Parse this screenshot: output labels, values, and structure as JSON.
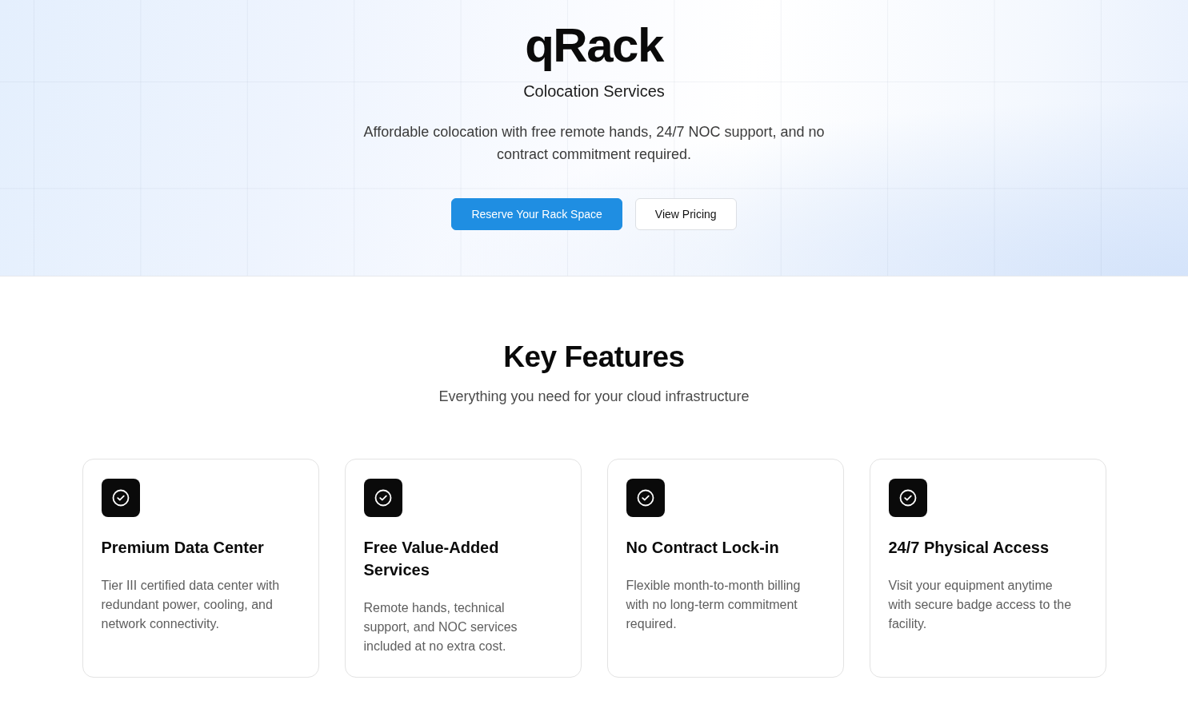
{
  "hero": {
    "brand": "qRack",
    "tagline": "Colocation Services",
    "description": "Affordable colocation with free remote hands, 24/7 NOC support, and no contract commitment required.",
    "buttons": [
      {
        "label": "Reserve Your Rack Space",
        "kind": "primary"
      },
      {
        "label": "View Pricing",
        "kind": "secondary"
      }
    ]
  },
  "features": {
    "title": "Key Features",
    "subtitle": "Everything you need for your cloud infrastructure",
    "cards": [
      {
        "title": "Premium Data Center",
        "description": "Tier III certified data center with redundant power, cooling, and network connectivity."
      },
      {
        "title": "Free Value-Added Services",
        "description": "Remote hands, technical support, and NOC services included at no extra cost."
      },
      {
        "title": "No Contract Lock-in",
        "description": "Flexible month-to-month billing with no long-term commitment required."
      },
      {
        "title": "24/7 Physical Access",
        "description": "Visit your equipment anytime with secure badge access to the facility."
      }
    ]
  }
}
